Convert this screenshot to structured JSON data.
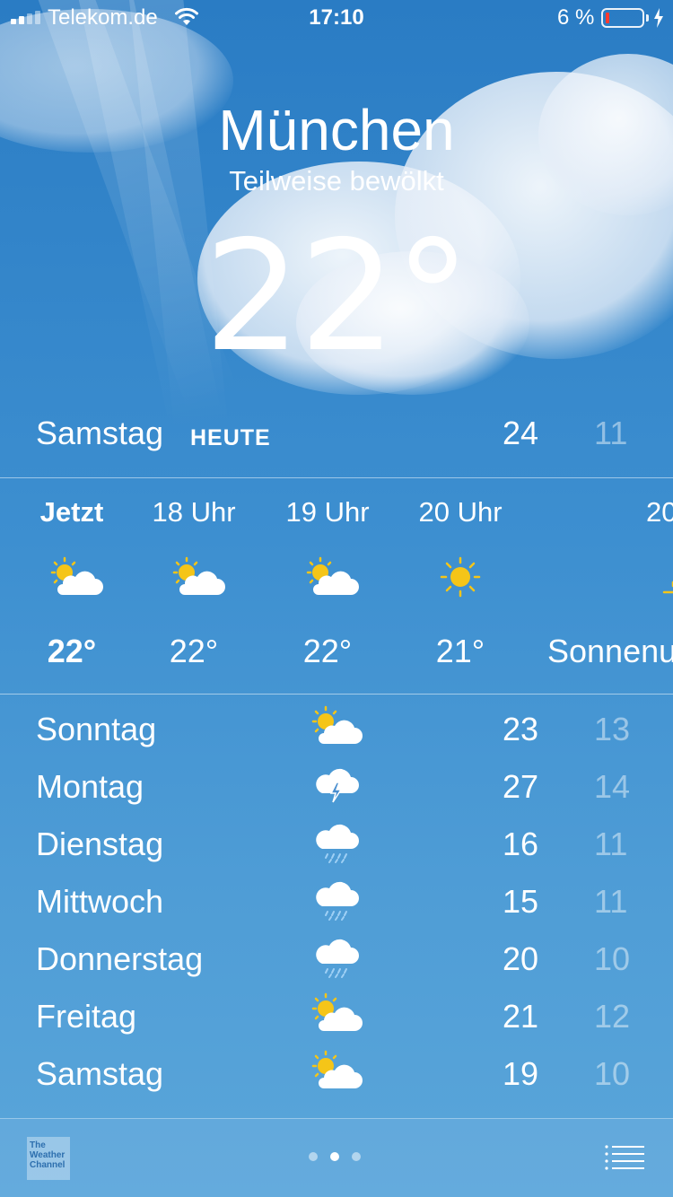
{
  "status_bar": {
    "carrier": "Telekom.de",
    "time": "17:10",
    "battery_percent": "6 %",
    "battery_level": 0.06,
    "icons": [
      "signal-icon",
      "wifi-icon",
      "battery-icon",
      "charging-bolt-icon"
    ]
  },
  "location": {
    "city": "München",
    "condition": "Teilweise bewölkt",
    "temperature": "22°"
  },
  "today": {
    "day": "Samstag",
    "badge": "HEUTE",
    "high": "24",
    "low": "11"
  },
  "hourly": [
    {
      "label": "Jetzt",
      "icon": "partly-cloudy-icon",
      "temp": "22°"
    },
    {
      "label": "18 Uhr",
      "icon": "partly-cloudy-icon",
      "temp": "22°"
    },
    {
      "label": "19 Uhr",
      "icon": "partly-cloudy-icon",
      "temp": "22°"
    },
    {
      "label": "20 Uhr",
      "icon": "sun-icon",
      "temp": "21°"
    },
    {
      "label": "20",
      "icon": "sunset-icon",
      "temp": "Sonnenu"
    }
  ],
  "daily": [
    {
      "day": "Sonntag",
      "icon": "partly-cloudy-icon",
      "high": "23",
      "low": "13"
    },
    {
      "day": "Montag",
      "icon": "thunderstorm-icon",
      "high": "27",
      "low": "14"
    },
    {
      "day": "Dienstag",
      "icon": "rain-icon",
      "high": "16",
      "low": "11"
    },
    {
      "day": "Mittwoch",
      "icon": "rain-icon",
      "high": "15",
      "low": "11"
    },
    {
      "day": "Donnerstag",
      "icon": "rain-icon",
      "high": "20",
      "low": "10"
    },
    {
      "day": "Freitag",
      "icon": "partly-cloudy-icon",
      "high": "21",
      "low": "12"
    },
    {
      "day": "Samstag",
      "icon": "partly-cloudy-icon",
      "high": "19",
      "low": "10"
    }
  ],
  "footer": {
    "logo_text": "The Weather Channel",
    "page_dots": 3,
    "active_page": 2,
    "icons": [
      "weather-channel-logo-icon",
      "list-icon"
    ]
  },
  "colors": {
    "sun": "#f5c518",
    "battery_low": "#ff3b30",
    "background_top": "#2a7cc4",
    "background_bottom": "#5aa6da"
  }
}
